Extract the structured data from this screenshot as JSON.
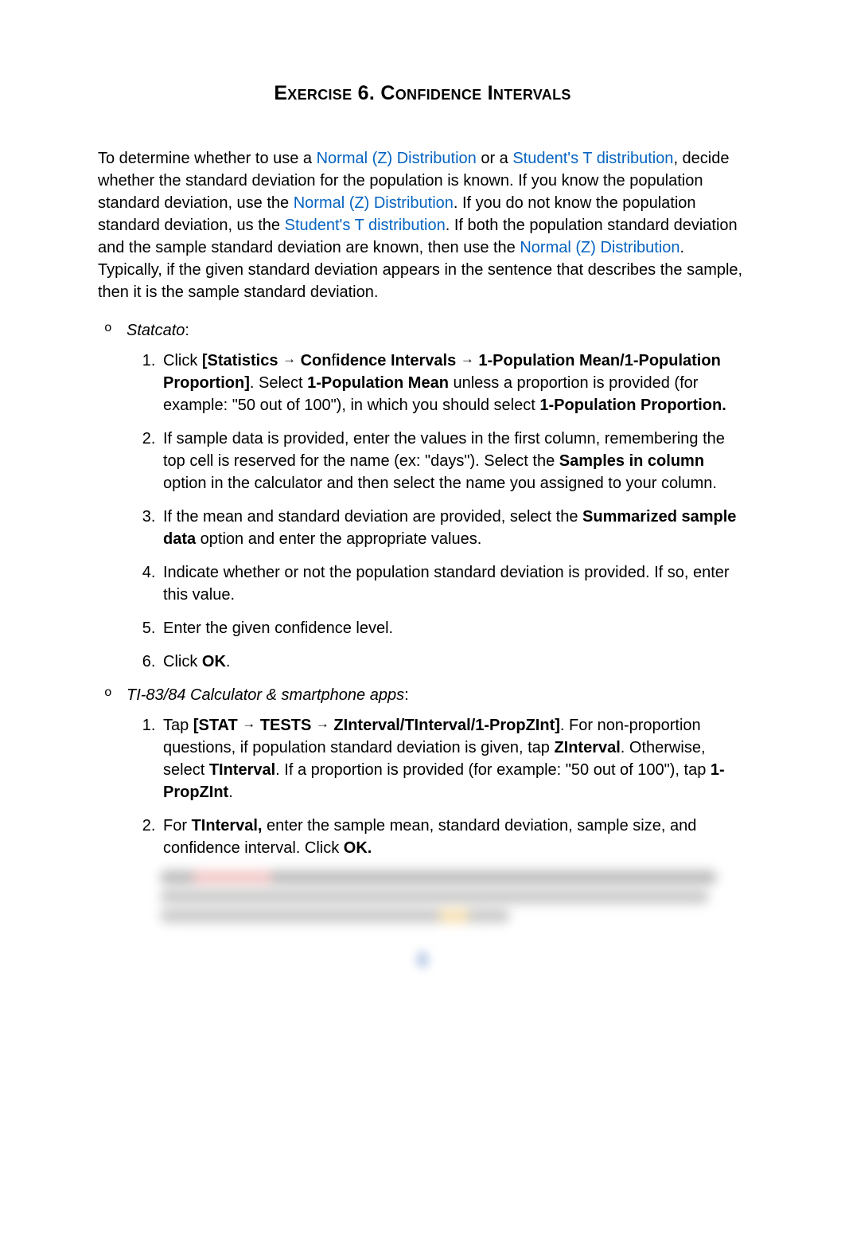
{
  "title_smallcaps_1": "Exercise",
  "title_num": " 6. ",
  "title_smallcaps_2": "Confidence",
  "title_smallcaps_3": " Intervals",
  "intro": {
    "t1": "To determine whether to use a ",
    "link1": "Normal (Z) Distribution",
    "t2": " or a ",
    "link2": "Student's T distribution",
    "t3": ", decide whether the standard deviation for the population is known. If you know the population standard deviation, use the ",
    "link3": "Normal (Z) Distribution",
    "t4": ". If you do not know the population standard deviation, us the ",
    "link4": "Student's T distribution",
    "t5": ". If both the population standard deviation and the sample standard deviation are known, then use the ",
    "link5": "Normal (Z) Distribution",
    "t6": ". Typically, if the given standard deviation appears in the sentence that describes the sample, then it is the sample standard deviation."
  },
  "statcato": {
    "label": "Statcato",
    "colon": ":",
    "s1": {
      "a": "Click ",
      "b": "[Statistics ",
      "c": " Con",
      "c2": "f",
      "c3": "idence Intervals ",
      "d": " 1-Population Mean/1-Population Proportion]",
      "e": ". Select ",
      "f": "1-Population Mean",
      "g": " unless a proportion is provided (for example: \"50 out of 100\"), in which you should select ",
      "h": "1-Population Proportion."
    },
    "s2": {
      "a": "If sample data is provided, enter the values in the first column, remembering the top cell is reserved for the name (ex: \"days\"). Select the ",
      "b": "Samples in column",
      "c": " option in the calculator and then select the name you assigned to your column."
    },
    "s3": {
      "a": "If the mean and standard deviation are provided, select the ",
      "b": "Summarized sample data",
      "c": " option and enter the appropriate values."
    },
    "s4": "Indicate whether or not the population standard deviation is provided. If so, enter this value.",
    "s5": "Enter the given confidence level.",
    "s6a": "Click ",
    "s6b": "OK",
    "s6c": "."
  },
  "ti": {
    "label": "TI-83/84 Calculator & smartphone apps",
    "colon": ":",
    "s1": {
      "a": "Tap ",
      "b": "[STAT ",
      "c": " TESTS ",
      "d": " ZInterval/TInterval/1-PropZInt]",
      "e": ". For non-proportion questions, if population standard deviation is given, tap ",
      "f": "ZInterval",
      "g": ". Otherwise, select ",
      "h": "TInterval",
      "i": ". If a proportion is provided (for example: \"50 out of 100\"), tap ",
      "j": "1-PropZInt",
      "k": "."
    },
    "s2": {
      "a": "For ",
      "b": "TInterval,",
      "c": " enter the sample mean, standard deviation, sample size, and confidence interval. Click ",
      "d": "OK."
    }
  }
}
